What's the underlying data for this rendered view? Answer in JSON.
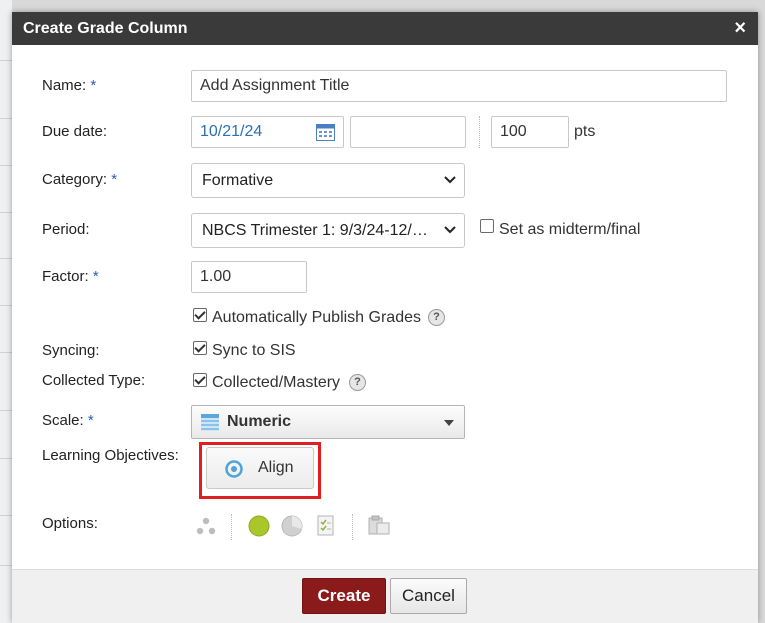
{
  "dialog": {
    "title": "Create Grade Column",
    "close_label": "×"
  },
  "form": {
    "name": {
      "label": "Name:",
      "required": "*",
      "value": "Add Assignment Title"
    },
    "due_date": {
      "label": "Due date:",
      "date_value": "10/21/24",
      "time_value": "",
      "points_value": "100",
      "points_unit": "pts"
    },
    "category": {
      "label": "Category:",
      "required": "*",
      "selected": "Formative"
    },
    "period": {
      "label": "Period:",
      "selected": "NBCS Trimester 1: 9/3/24-12/2...",
      "midterm_label": "Set as midterm/final",
      "midterm_checked": false
    },
    "factor": {
      "label": "Factor:",
      "required": "*",
      "value": "1.00"
    },
    "auto_publish": {
      "label": "Automatically Publish Grades",
      "checked": true
    },
    "syncing": {
      "label": "Syncing:",
      "option_label": "Sync to SIS",
      "checked": true
    },
    "collected_type": {
      "label": "Collected Type:",
      "option_label": "Collected/Mastery",
      "checked": true
    },
    "scale": {
      "label": "Scale:",
      "required": "*",
      "selected": "Numeric"
    },
    "learning_objectives": {
      "label": "Learning Objectives:",
      "button_label": "Align"
    },
    "options": {
      "label": "Options:"
    }
  },
  "footer": {
    "create_label": "Create",
    "cancel_label": "Cancel"
  },
  "help_glyph": "?",
  "colors": {
    "titlebar": "#3a3a3a",
    "required_star": "#2a5db0",
    "create_button": "#8b1a1a",
    "highlight_box": "#e02020",
    "date_text": "#2a6fb8"
  }
}
